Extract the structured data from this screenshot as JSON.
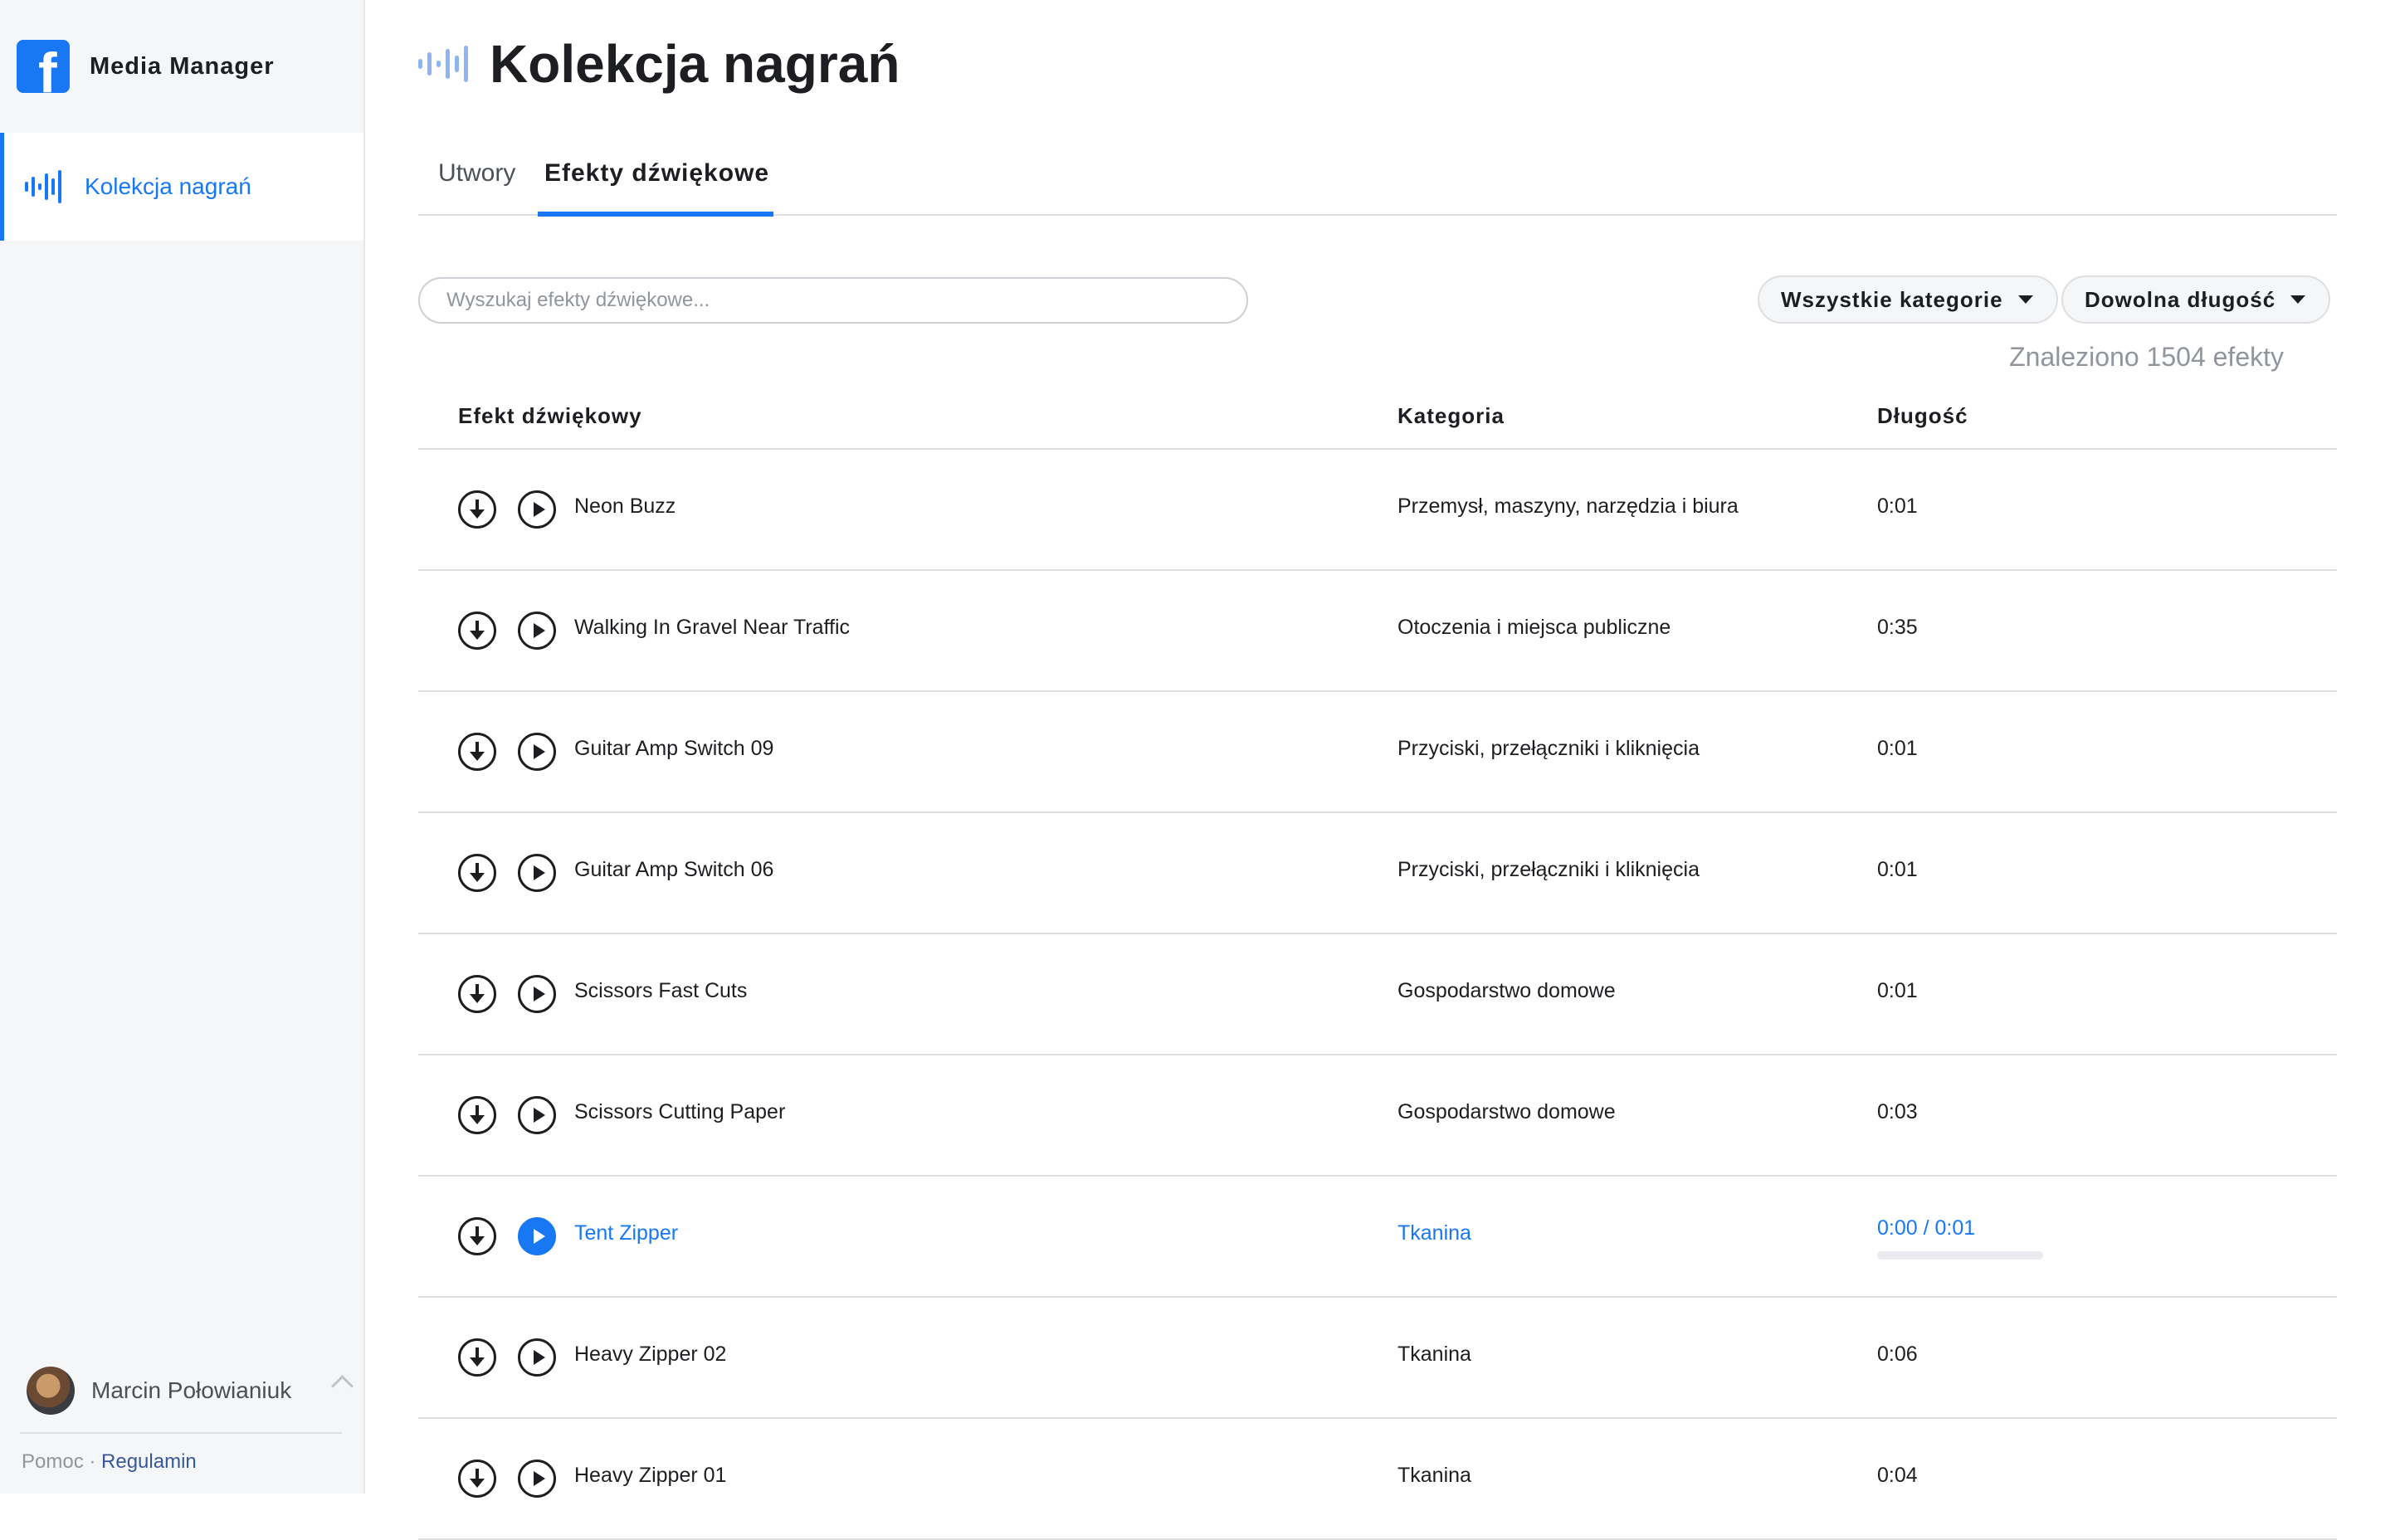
{
  "app": {
    "name": "Media Manager",
    "logo_letter": "f",
    "brand_color": "#1877f2"
  },
  "sidebar": {
    "items": [
      {
        "label": "Kolekcja nagrań",
        "icon": "sound-wave-icon",
        "active": true
      }
    ],
    "user": {
      "name": "Marcin Połowianiuk"
    },
    "footer": {
      "help": "Pomoc",
      "separator": " · ",
      "terms": "Regulamin"
    }
  },
  "header": {
    "title": "Kolekcja nagrań"
  },
  "tabs": [
    {
      "label": "Utwory",
      "active": false
    },
    {
      "label": "Efekty dźwiękowe",
      "active": true
    }
  ],
  "search": {
    "placeholder": "Wyszukaj efekty dźwiękowe...",
    "value": ""
  },
  "filters": {
    "category": "Wszystkie kategorie",
    "length": "Dowolna długość"
  },
  "results_count": "Znaleziono 1504 efekty",
  "table": {
    "columns": [
      "Efekt dźwiękowy",
      "Kategoria",
      "Długość"
    ],
    "rows": [
      {
        "name": "Neon Buzz",
        "category": "Przemysł, maszyny, narzędzia i biura",
        "duration": "0:01"
      },
      {
        "name": "Walking In Gravel Near Traffic",
        "category": "Otoczenia i miejsca publiczne",
        "duration": "0:35"
      },
      {
        "name": "Guitar Amp Switch 09",
        "category": "Przyciski, przełączniki i kliknięcia",
        "duration": "0:01"
      },
      {
        "name": "Guitar Amp Switch 06",
        "category": "Przyciski, przełączniki i kliknięcia",
        "duration": "0:01"
      },
      {
        "name": "Scissors Fast Cuts",
        "category": "Gospodarstwo domowe",
        "duration": "0:01"
      },
      {
        "name": "Scissors Cutting Paper",
        "category": "Gospodarstwo domowe",
        "duration": "0:03"
      },
      {
        "name": "Tent Zipper",
        "category": "Tkanina",
        "duration": "0:00 / 0:01",
        "playing": true,
        "progress": 0
      },
      {
        "name": "Heavy Zipper 02",
        "category": "Tkanina",
        "duration": "0:06"
      },
      {
        "name": "Heavy Zipper 01",
        "category": "Tkanina",
        "duration": "0:04"
      }
    ]
  },
  "colors": {
    "accent": "#1877f2",
    "text": "#1c1e21",
    "muted": "#90949c",
    "divider": "#dddfe2"
  }
}
